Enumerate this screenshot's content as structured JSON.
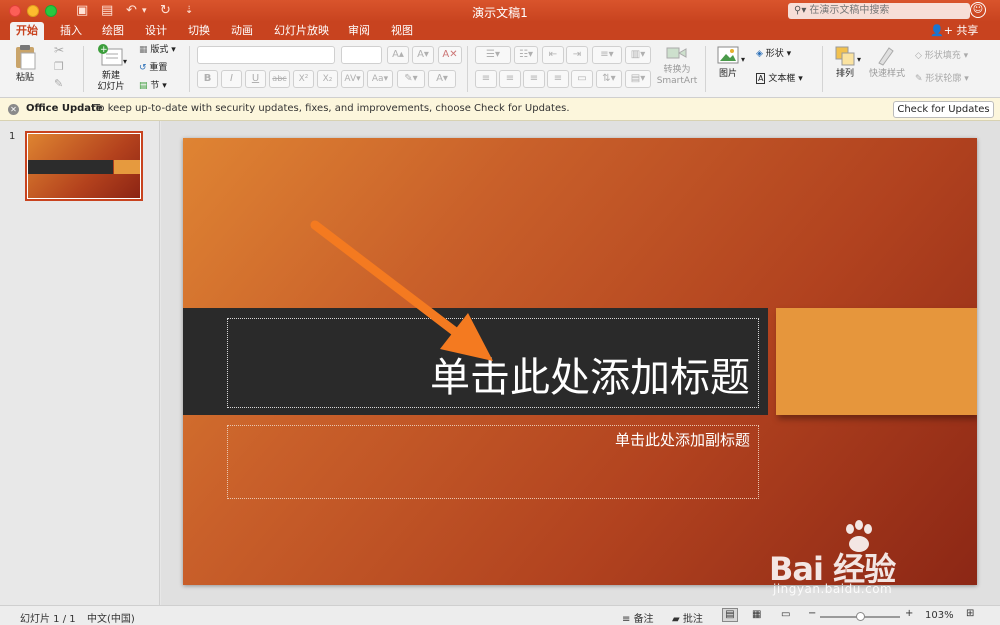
{
  "window": {
    "title": "演示文稿1",
    "search_placeholder": "在演示文稿中搜索",
    "share_label": "共享"
  },
  "tabs": [
    "开始",
    "插入",
    "绘图",
    "设计",
    "切换",
    "动画",
    "幻灯片放映",
    "审阅",
    "视图"
  ],
  "ribbon": {
    "paste": "粘贴",
    "new_slide": "新建\n幻灯片",
    "layout": "版式",
    "reset": "重置",
    "section": "节",
    "convert_smartart": "转换为\nSmartArt",
    "picture": "图片",
    "shape": "形状",
    "textbox": "文本框",
    "arrange": "排列",
    "quick_styles": "快速样式",
    "shape_fill": "形状填充",
    "shape_outline": "形状轮廓",
    "font_buttons": [
      "B",
      "I",
      "U",
      "abc",
      "X²",
      "X₂"
    ]
  },
  "update_bar": {
    "title": "Office Update",
    "message": "To keep up-to-date with security updates, fixes, and improvements, choose Check for Updates.",
    "button": "Check for Updates"
  },
  "thumbnails": {
    "slide_number": "1"
  },
  "slide": {
    "title_placeholder": "单击此处添加标题",
    "subtitle_placeholder": "单击此处添加副标题",
    "colors": {
      "band": "#2a2a2a",
      "accent_block": "#e6963c",
      "arrow": "#f47a20"
    }
  },
  "watermark": {
    "logo": "Bai  经验",
    "url": "jingyan.baidu.com"
  },
  "statusbar": {
    "slide_count": "幻灯片 1 / 1",
    "language": "中文(中国)",
    "notes": "备注",
    "comments": "批注",
    "zoom_level": "103%",
    "zoom_fraction": 0.5
  }
}
